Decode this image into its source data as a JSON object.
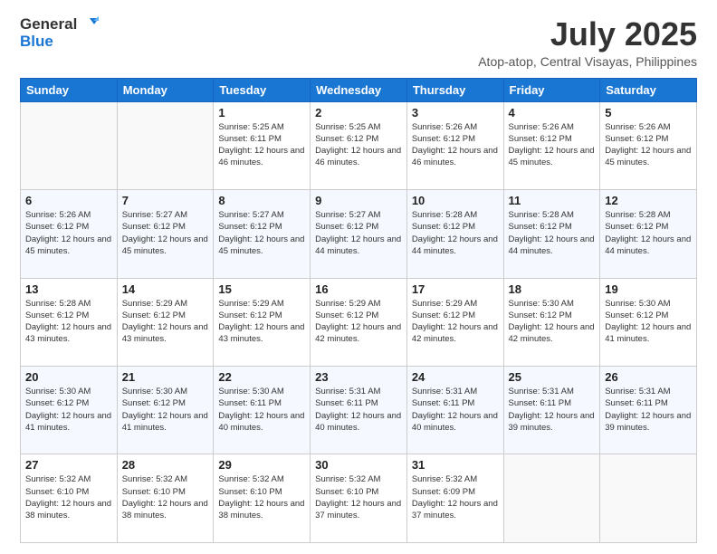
{
  "logo": {
    "line1": "General",
    "line2": "Blue"
  },
  "title": "July 2025",
  "location": "Atop-atop, Central Visayas, Philippines",
  "days_of_week": [
    "Sunday",
    "Monday",
    "Tuesday",
    "Wednesday",
    "Thursday",
    "Friday",
    "Saturday"
  ],
  "weeks": [
    [
      {
        "day": "",
        "info": ""
      },
      {
        "day": "",
        "info": ""
      },
      {
        "day": "1",
        "info": "Sunrise: 5:25 AM\nSunset: 6:11 PM\nDaylight: 12 hours and 46 minutes."
      },
      {
        "day": "2",
        "info": "Sunrise: 5:25 AM\nSunset: 6:12 PM\nDaylight: 12 hours and 46 minutes."
      },
      {
        "day": "3",
        "info": "Sunrise: 5:26 AM\nSunset: 6:12 PM\nDaylight: 12 hours and 46 minutes."
      },
      {
        "day": "4",
        "info": "Sunrise: 5:26 AM\nSunset: 6:12 PM\nDaylight: 12 hours and 45 minutes."
      },
      {
        "day": "5",
        "info": "Sunrise: 5:26 AM\nSunset: 6:12 PM\nDaylight: 12 hours and 45 minutes."
      }
    ],
    [
      {
        "day": "6",
        "info": "Sunrise: 5:26 AM\nSunset: 6:12 PM\nDaylight: 12 hours and 45 minutes."
      },
      {
        "day": "7",
        "info": "Sunrise: 5:27 AM\nSunset: 6:12 PM\nDaylight: 12 hours and 45 minutes."
      },
      {
        "day": "8",
        "info": "Sunrise: 5:27 AM\nSunset: 6:12 PM\nDaylight: 12 hours and 45 minutes."
      },
      {
        "day": "9",
        "info": "Sunrise: 5:27 AM\nSunset: 6:12 PM\nDaylight: 12 hours and 44 minutes."
      },
      {
        "day": "10",
        "info": "Sunrise: 5:28 AM\nSunset: 6:12 PM\nDaylight: 12 hours and 44 minutes."
      },
      {
        "day": "11",
        "info": "Sunrise: 5:28 AM\nSunset: 6:12 PM\nDaylight: 12 hours and 44 minutes."
      },
      {
        "day": "12",
        "info": "Sunrise: 5:28 AM\nSunset: 6:12 PM\nDaylight: 12 hours and 44 minutes."
      }
    ],
    [
      {
        "day": "13",
        "info": "Sunrise: 5:28 AM\nSunset: 6:12 PM\nDaylight: 12 hours and 43 minutes."
      },
      {
        "day": "14",
        "info": "Sunrise: 5:29 AM\nSunset: 6:12 PM\nDaylight: 12 hours and 43 minutes."
      },
      {
        "day": "15",
        "info": "Sunrise: 5:29 AM\nSunset: 6:12 PM\nDaylight: 12 hours and 43 minutes."
      },
      {
        "day": "16",
        "info": "Sunrise: 5:29 AM\nSunset: 6:12 PM\nDaylight: 12 hours and 42 minutes."
      },
      {
        "day": "17",
        "info": "Sunrise: 5:29 AM\nSunset: 6:12 PM\nDaylight: 12 hours and 42 minutes."
      },
      {
        "day": "18",
        "info": "Sunrise: 5:30 AM\nSunset: 6:12 PM\nDaylight: 12 hours and 42 minutes."
      },
      {
        "day": "19",
        "info": "Sunrise: 5:30 AM\nSunset: 6:12 PM\nDaylight: 12 hours and 41 minutes."
      }
    ],
    [
      {
        "day": "20",
        "info": "Sunrise: 5:30 AM\nSunset: 6:12 PM\nDaylight: 12 hours and 41 minutes."
      },
      {
        "day": "21",
        "info": "Sunrise: 5:30 AM\nSunset: 6:12 PM\nDaylight: 12 hours and 41 minutes."
      },
      {
        "day": "22",
        "info": "Sunrise: 5:30 AM\nSunset: 6:11 PM\nDaylight: 12 hours and 40 minutes."
      },
      {
        "day": "23",
        "info": "Sunrise: 5:31 AM\nSunset: 6:11 PM\nDaylight: 12 hours and 40 minutes."
      },
      {
        "day": "24",
        "info": "Sunrise: 5:31 AM\nSunset: 6:11 PM\nDaylight: 12 hours and 40 minutes."
      },
      {
        "day": "25",
        "info": "Sunrise: 5:31 AM\nSunset: 6:11 PM\nDaylight: 12 hours and 39 minutes."
      },
      {
        "day": "26",
        "info": "Sunrise: 5:31 AM\nSunset: 6:11 PM\nDaylight: 12 hours and 39 minutes."
      }
    ],
    [
      {
        "day": "27",
        "info": "Sunrise: 5:32 AM\nSunset: 6:10 PM\nDaylight: 12 hours and 38 minutes."
      },
      {
        "day": "28",
        "info": "Sunrise: 5:32 AM\nSunset: 6:10 PM\nDaylight: 12 hours and 38 minutes."
      },
      {
        "day": "29",
        "info": "Sunrise: 5:32 AM\nSunset: 6:10 PM\nDaylight: 12 hours and 38 minutes."
      },
      {
        "day": "30",
        "info": "Sunrise: 5:32 AM\nSunset: 6:10 PM\nDaylight: 12 hours and 37 minutes."
      },
      {
        "day": "31",
        "info": "Sunrise: 5:32 AM\nSunset: 6:09 PM\nDaylight: 12 hours and 37 minutes."
      },
      {
        "day": "",
        "info": ""
      },
      {
        "day": "",
        "info": ""
      }
    ]
  ]
}
